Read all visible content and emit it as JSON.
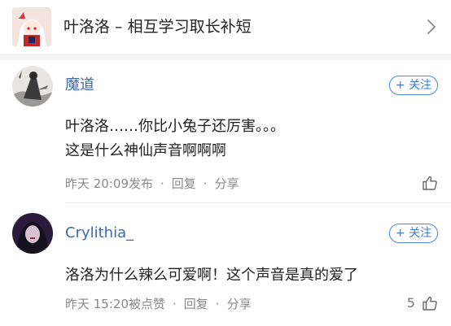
{
  "header": {
    "title": "叶洛洛 – 相互学习取长补短",
    "thumb_icon": "anime-girl-thumbnail",
    "chevron_icon": "chevron-right-icon"
  },
  "comments": [
    {
      "username": "魔道",
      "avatar_icon": "ink-painting-avatar",
      "follow_label": "+ 关注",
      "lines": [
        "叶洛洛……你比小兔子还厉害。。。",
        "这是什么神仙声音啊啊啊"
      ],
      "time": "昨天 20:09发布",
      "reply_label": "回复",
      "share_label": "分享",
      "like_count": "",
      "like_icon": "thumb-up-icon"
    },
    {
      "username": "Crylithia_",
      "avatar_icon": "dark-portrait-avatar",
      "follow_label": "+ 关注",
      "lines": [
        "洛洛为什么辣么可爱啊！这个声音是真的爱了"
      ],
      "time": "昨天 15:20被点赞",
      "reply_label": "回复",
      "share_label": "分享",
      "like_count": "5",
      "like_icon": "thumb-up-icon"
    }
  ],
  "colors": {
    "link_blue": "#3d6aa8",
    "follow_blue": "#4a86d6",
    "meta_gray": "#8a8a8a",
    "separator": "#f4f4f4"
  }
}
